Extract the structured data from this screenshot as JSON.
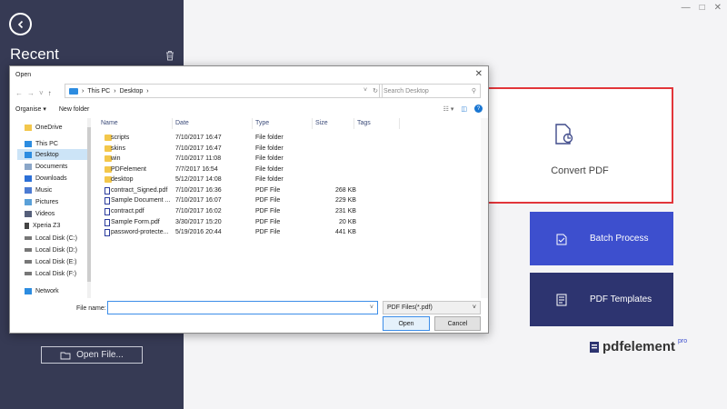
{
  "sidebar": {
    "title": "Recent",
    "open_file_label": "Open File..."
  },
  "main": {
    "convert_label": "Convert PDF",
    "batch_label": "Batch Process",
    "templates_label": "PDF Templates",
    "brand_name": "pdfelement",
    "brand_suffix": "pro"
  },
  "dialog": {
    "title": "Open",
    "breadcrumb": [
      "This PC",
      "Desktop"
    ],
    "search_placeholder": "Search Desktop",
    "toolbar": {
      "organise": "Organise",
      "new_folder": "New folder"
    },
    "nav": [
      {
        "label": "OneDrive",
        "icon": "folder-icon"
      },
      {
        "label": "This PC",
        "icon": "computer-icon"
      },
      {
        "label": "Desktop",
        "icon": "desktop-icon",
        "selected": true
      },
      {
        "label": "Documents",
        "icon": "documents-icon"
      },
      {
        "label": "Downloads",
        "icon": "downloads-icon"
      },
      {
        "label": "Music",
        "icon": "music-icon"
      },
      {
        "label": "Pictures",
        "icon": "pictures-icon"
      },
      {
        "label": "Videos",
        "icon": "videos-icon"
      },
      {
        "label": "Xperia Z3",
        "icon": "phone-icon"
      },
      {
        "label": "Local Disk (C:)",
        "icon": "disk-icon"
      },
      {
        "label": "Local Disk (D:)",
        "icon": "disk-icon"
      },
      {
        "label": "Local Disk (E:)",
        "icon": "disk-icon"
      },
      {
        "label": "Local Disk (F:)",
        "icon": "disk-icon"
      },
      {
        "label": "Network",
        "icon": "network-icon"
      }
    ],
    "columns": [
      "Name",
      "Date",
      "Type",
      "Size",
      "Tags"
    ],
    "files": [
      {
        "name": "scripts",
        "date": "7/10/2017 16:47",
        "type": "File folder",
        "size": "",
        "kind": "folder"
      },
      {
        "name": "skins",
        "date": "7/10/2017 16:47",
        "type": "File folder",
        "size": "",
        "kind": "folder"
      },
      {
        "name": "win",
        "date": "7/10/2017 11:08",
        "type": "File folder",
        "size": "",
        "kind": "folder"
      },
      {
        "name": "PDFelement",
        "date": "7/7/2017 16:54",
        "type": "File folder",
        "size": "",
        "kind": "folder"
      },
      {
        "name": "desktop",
        "date": "5/12/2017 14:08",
        "type": "File folder",
        "size": "",
        "kind": "folder"
      },
      {
        "name": "contract_Signed.pdf",
        "date": "7/10/2017 16:36",
        "type": "PDF File",
        "size": "268 KB",
        "kind": "pdf"
      },
      {
        "name": "Sample Document ...",
        "date": "7/10/2017 16:07",
        "type": "PDF File",
        "size": "229 KB",
        "kind": "pdf"
      },
      {
        "name": "contract.pdf",
        "date": "7/10/2017 16:02",
        "type": "PDF File",
        "size": "231 KB",
        "kind": "pdf"
      },
      {
        "name": "Sample Form.pdf",
        "date": "3/30/2017 15:20",
        "type": "PDF File",
        "size": "20 KB",
        "kind": "pdf"
      },
      {
        "name": "password-protecte...",
        "date": "5/19/2016 20:44",
        "type": "PDF File",
        "size": "441 KB",
        "kind": "pdf"
      }
    ],
    "file_name_label": "File name:",
    "file_name_value": "",
    "file_type": "PDF Files(*.pdf)",
    "open_label": "Open",
    "cancel_label": "Cancel"
  },
  "colors": {
    "sidebar_bg": "#363a54",
    "accent_red": "#e2353a",
    "batch_tile": "#3d4fce",
    "templates_tile": "#2d3470"
  }
}
